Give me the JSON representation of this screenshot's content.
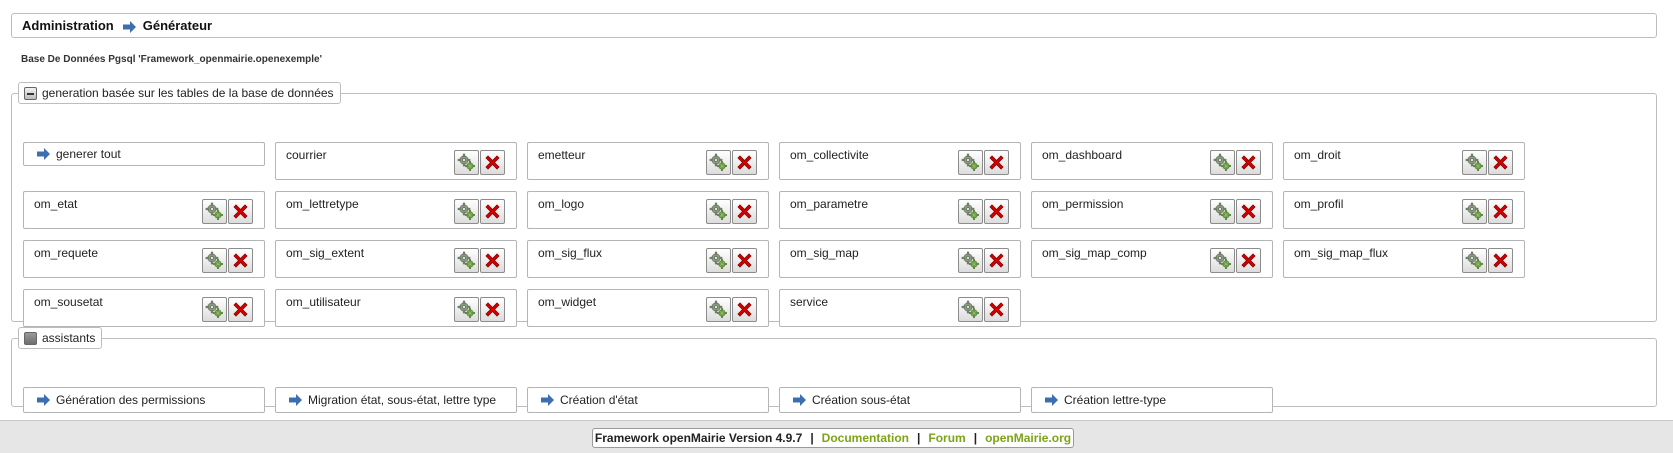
{
  "breadcrumb": {
    "root": "Administration",
    "current": "Générateur"
  },
  "db_info": "Base De Données Pgsql 'Framework_openmairie.openexemple'",
  "generation": {
    "legend": "generation basée sur les tables de la base de données",
    "generate_all": "generer tout",
    "tables": [
      "courrier",
      "emetteur",
      "om_collectivite",
      "om_dashboard",
      "om_droit",
      "om_etat",
      "om_lettretype",
      "om_logo",
      "om_parametre",
      "om_permission",
      "om_profil",
      "om_requete",
      "om_sig_extent",
      "om_sig_flux",
      "om_sig_map",
      "om_sig_map_comp",
      "om_sig_map_flux",
      "om_sousetat",
      "om_utilisateur",
      "om_widget",
      "service"
    ],
    "icons": {
      "generate": "gears-icon",
      "delete": "red-x-icon"
    }
  },
  "assistants": {
    "legend": "assistants",
    "items": [
      "Génération des permissions",
      "Migration état, sous-état, lettre type",
      "Création d'état",
      "Création sous-état",
      "Création lettre-type"
    ]
  },
  "footer": {
    "version": "Framework openMairie Version 4.9.7",
    "links": [
      "Documentation",
      "Forum",
      "openMairie.org"
    ],
    "link_color": "#7ca416"
  },
  "colors": {
    "arrow": "#3d6fb0",
    "delete": "#d40000",
    "border": "#bdbdbd"
  }
}
